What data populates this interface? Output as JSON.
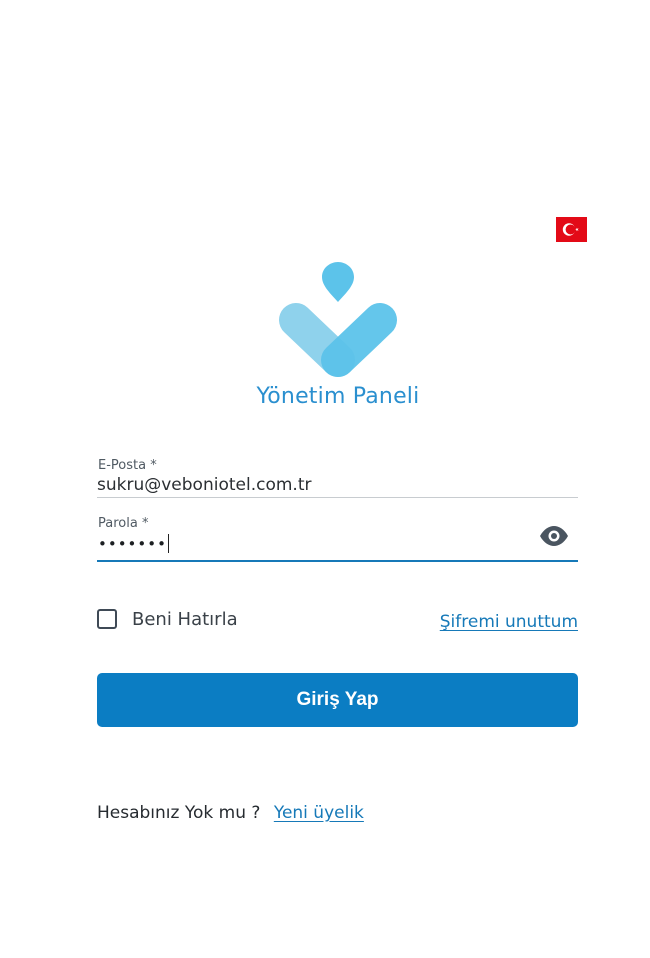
{
  "language": {
    "selected": "tr",
    "flag_icon": "turkey-flag-icon"
  },
  "brand": {
    "title": "Yönetim Paneli",
    "logo_colors": [
      "#5cc3ea",
      "#8fd2ec"
    ]
  },
  "form": {
    "email": {
      "label": "E-Posta *",
      "value": "sukru@veboniotel.com.tr"
    },
    "password": {
      "label": "Parola *",
      "masked_value": "•••••••",
      "toggle_icon": "eye-icon"
    },
    "remember_me": {
      "label": "Beni Hatırla",
      "checked": false
    },
    "forgot_password": "Şifremi unuttum",
    "submit_label": "Giriş Yap"
  },
  "signup": {
    "question": "Hesabınız Yok mu ?",
    "link_label": "Yeni üyelik"
  },
  "colors": {
    "accent": "#0b7dc3",
    "link": "#1679b8",
    "title": "#2a8fcf"
  }
}
